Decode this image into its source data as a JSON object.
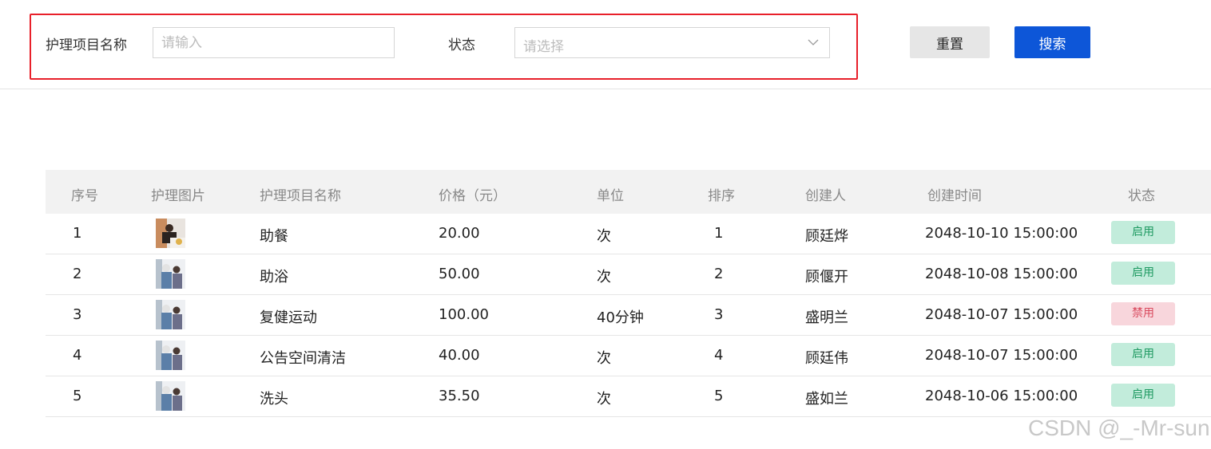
{
  "search": {
    "name_label": "护理项目名称",
    "name_placeholder": "请输入",
    "status_label": "状态",
    "status_placeholder": "请选择",
    "reset_label": "重置",
    "search_label": "搜索"
  },
  "table": {
    "headers": [
      "序号",
      "护理图片",
      "护理项目名称",
      "价格（元）",
      "单位",
      "排序",
      "创建人",
      "创建时间",
      "状态"
    ],
    "rows": [
      {
        "index": "1",
        "name": "助餐",
        "price": "20.00",
        "unit": "次",
        "sort": "1",
        "creator": "顾廷烨",
        "created": "2048-10-10 15:00:00",
        "status": "启用",
        "status_type": "enabled"
      },
      {
        "index": "2",
        "name": "助浴",
        "price": "50.00",
        "unit": "次",
        "sort": "2",
        "creator": "顾偃开",
        "created": "2048-10-08 15:00:00",
        "status": "启用",
        "status_type": "enabled"
      },
      {
        "index": "3",
        "name": "复健运动",
        "price": "100.00",
        "unit": "40分钟",
        "sort": "3",
        "creator": "盛明兰",
        "created": "2048-10-07 15:00:00",
        "status": "禁用",
        "status_type": "disabled"
      },
      {
        "index": "4",
        "name": "公告空间清洁",
        "price": "40.00",
        "unit": "次",
        "sort": "4",
        "creator": "顾廷伟",
        "created": "2048-10-07 15:00:00",
        "status": "启用",
        "status_type": "enabled"
      },
      {
        "index": "5",
        "name": "洗头",
        "price": "35.50",
        "unit": "次",
        "sort": "5",
        "creator": "盛如兰",
        "created": "2048-10-06 15:00:00",
        "status": "启用",
        "status_type": "enabled"
      }
    ]
  },
  "colors": {
    "primary": "#0d56d8",
    "highlight_border": "#e8202a",
    "enabled_bg": "#c2ecdb",
    "disabled_bg": "#f8d6dc"
  },
  "icons": {
    "select_arrow": "chevron-down-icon",
    "row_image": "care-photo"
  },
  "watermark": "CSDN @_-Mr-sun"
}
